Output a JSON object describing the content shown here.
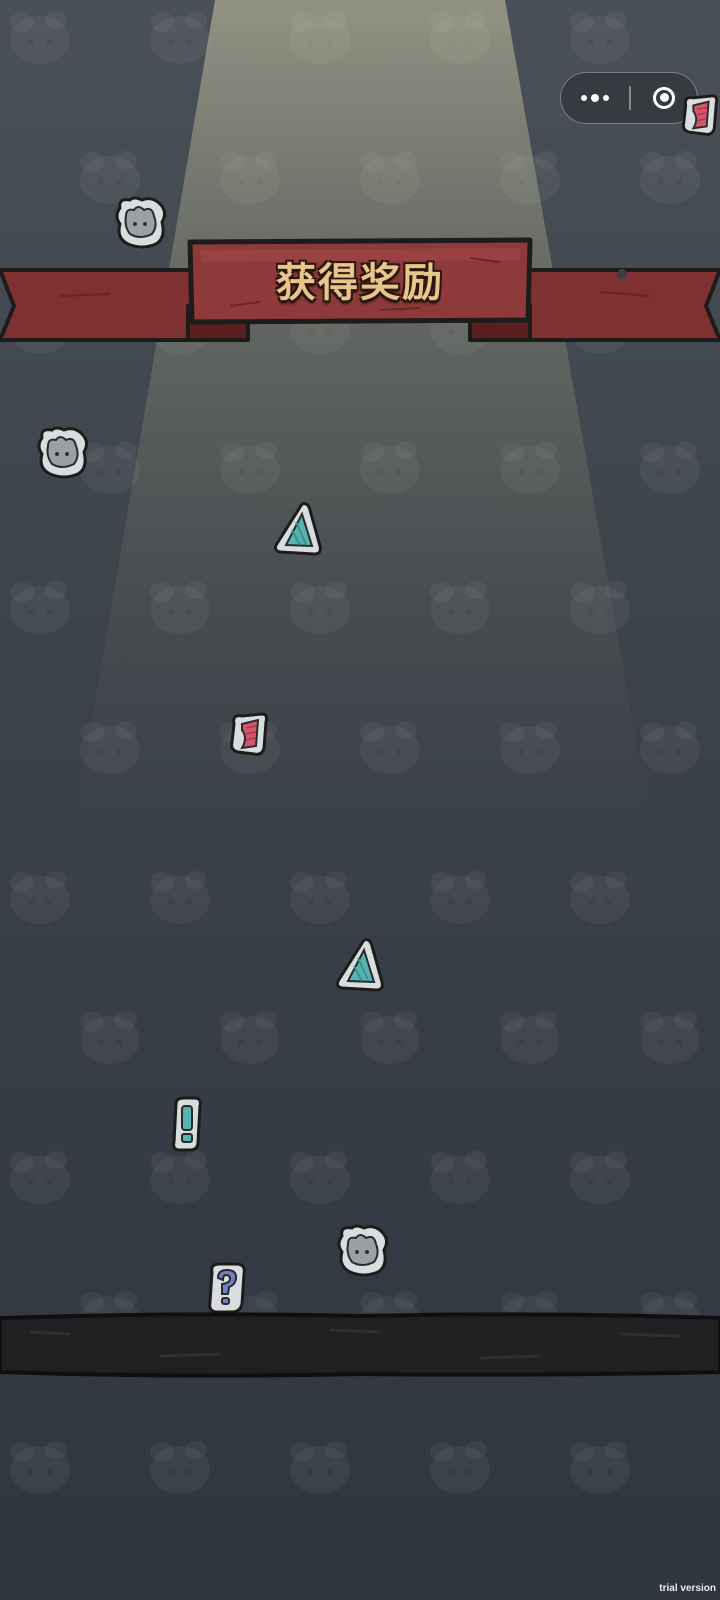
{
  "screen": {
    "title": "获得奖励"
  },
  "capsule": {
    "more_icon": "more-dots-icon",
    "close_icon": "target-close-icon"
  },
  "colors": {
    "background_top": "#4a5058",
    "background_bottom": "#30363f",
    "banner_red": "#8e3a3a",
    "banner_dark": "#6a2626",
    "title_gold": "#e9c58a",
    "outline": "#1e1b1b",
    "floor": "#1f1f22",
    "card_bg": "#c9cdd1",
    "teal": "#55b4b0",
    "pink": "#d5566a",
    "blue": "#6f82c9"
  },
  "rewards": [
    {
      "kind": "mouse",
      "icon": "mouse-card-icon"
    },
    {
      "kind": "mouse",
      "icon": "mouse-card-icon"
    },
    {
      "kind": "triangle",
      "icon": "teal-triangle-icon"
    },
    {
      "kind": "paper",
      "icon": "pink-paper-icon"
    },
    {
      "kind": "triangle",
      "icon": "teal-triangle-icon"
    },
    {
      "kind": "exclaim",
      "icon": "exclamation-card-icon"
    },
    {
      "kind": "mouse",
      "icon": "mouse-card-icon"
    },
    {
      "kind": "question",
      "icon": "question-card-icon"
    },
    {
      "kind": "paper",
      "icon": "pink-paper-icon"
    }
  ],
  "watermark": "trial version"
}
